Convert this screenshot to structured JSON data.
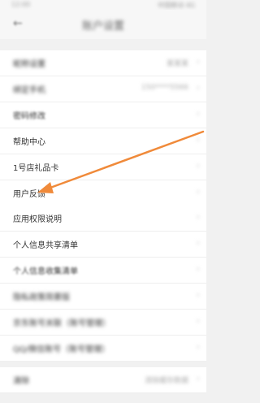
{
  "status": {
    "left": "12:00",
    "right": "中国移动 4G"
  },
  "nav": {
    "title": "账户设置"
  },
  "group1": [
    {
      "label": "昵称设置",
      "value": "某某某",
      "chevron": "›"
    },
    {
      "label": "绑定手机",
      "value": "150****5566",
      "chevron": "›"
    },
    {
      "label": "密码修改",
      "value": "",
      "chevron": "›"
    },
    {
      "label": "帮助中心",
      "value": "",
      "chevron": "›"
    },
    {
      "label": "1号店礼品卡",
      "value": "",
      "chevron": "›"
    },
    {
      "label": "用户反馈",
      "value": "",
      "chevron": "›"
    }
  ],
  "group2": [
    {
      "label": "应用权限说明",
      "value": "",
      "chevron": "›"
    },
    {
      "label": "个人信息共享清单",
      "value": "",
      "chevron": "›"
    },
    {
      "label": "个人信息收集清单",
      "value": "",
      "chevron": "›"
    },
    {
      "label": "隐私政策简要版",
      "value": "",
      "chevron": "›"
    }
  ],
  "group3": [
    {
      "label": "京东账号关联（账号管理）",
      "value": "",
      "chevron": "›"
    },
    {
      "label": "QQ/微信账号（账号管理）",
      "value": "",
      "chevron": "›"
    }
  ],
  "group4": [
    {
      "label": "清除",
      "value": "清除缓存数据",
      "chevron": "›"
    }
  ],
  "annotation": {
    "color": "#f08a3a"
  }
}
